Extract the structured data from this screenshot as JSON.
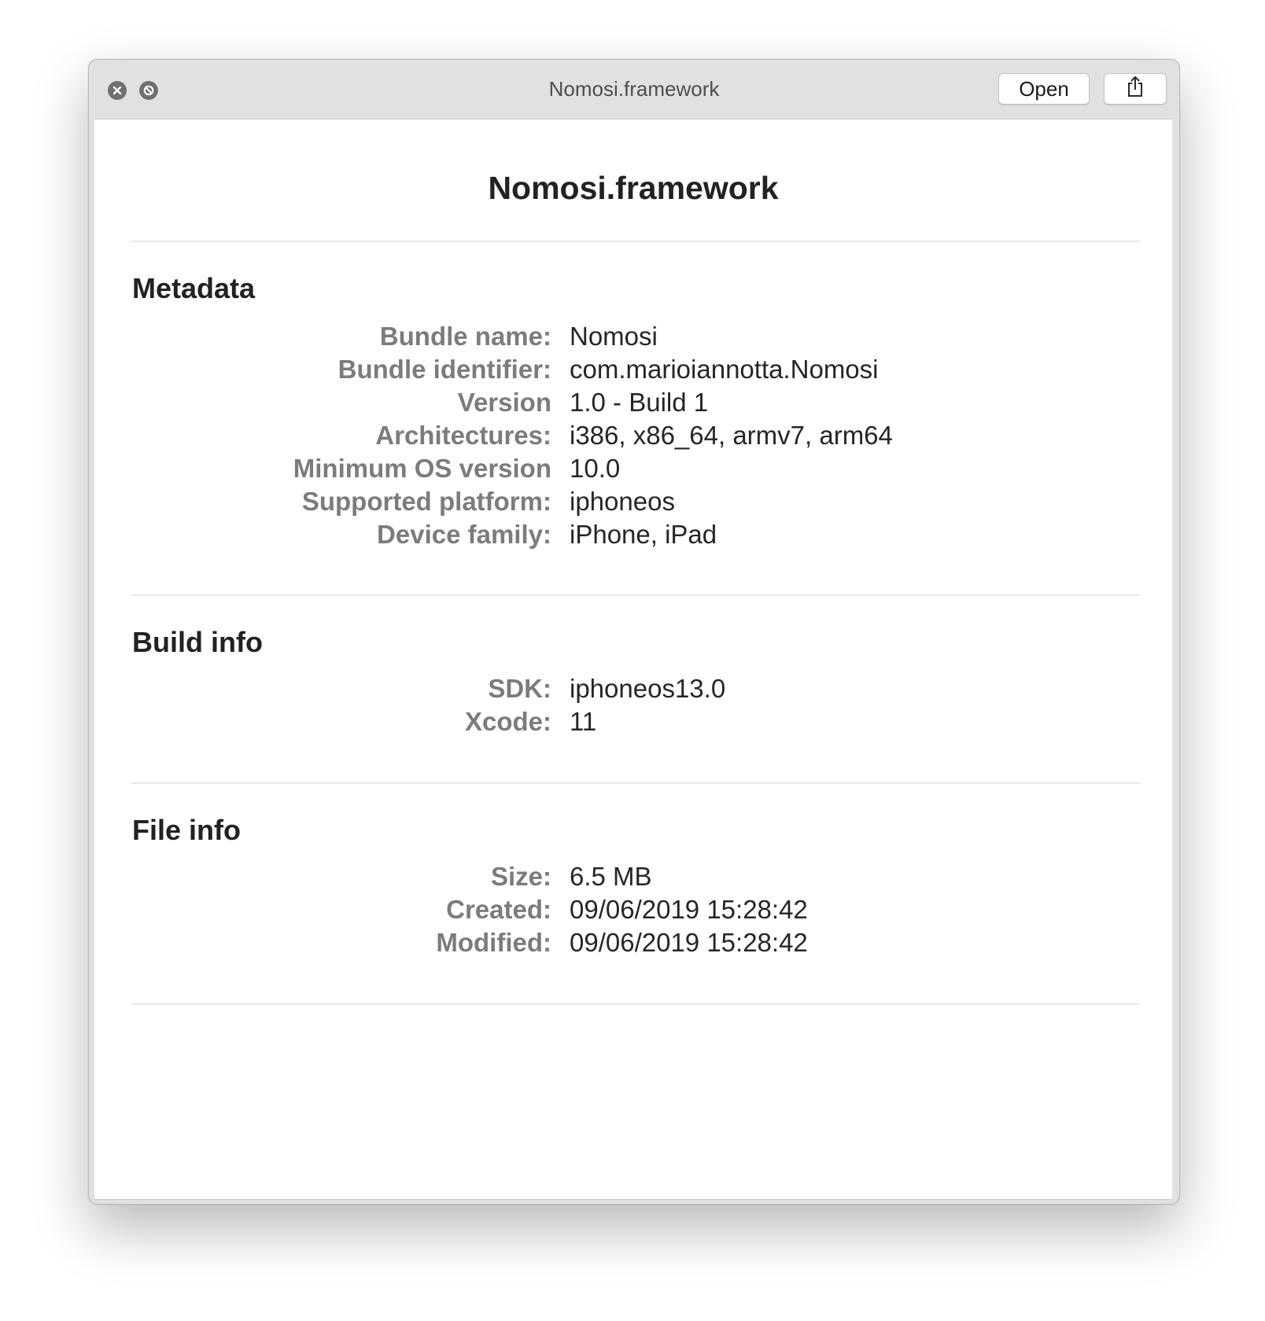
{
  "window": {
    "title": "Nomosi.framework",
    "open_label": "Open"
  },
  "icons": {
    "close": "close-circle-icon",
    "block": "block-circle-icon",
    "share": "share-icon"
  },
  "document": {
    "title": "Nomosi.framework"
  },
  "metadata": {
    "heading": "Metadata",
    "rows": [
      {
        "label": "Bundle name:",
        "value": "Nomosi"
      },
      {
        "label": "Bundle identifier:",
        "value": "com.marioiannotta.Nomosi"
      },
      {
        "label": "Version",
        "value": "1.0 - Build 1"
      },
      {
        "label": "Architectures:",
        "value": "i386, x86_64, armv7, arm64"
      },
      {
        "label": "Minimum OS version",
        "value": "10.0"
      },
      {
        "label": "Supported platform:",
        "value": "iphoneos"
      },
      {
        "label": "Device family:",
        "value": "iPhone, iPad"
      }
    ]
  },
  "build_info": {
    "heading": "Build info",
    "rows": [
      {
        "label": "SDK:",
        "value": "iphoneos13.0"
      },
      {
        "label": "Xcode:",
        "value": "11"
      }
    ]
  },
  "file_info": {
    "heading": "File info",
    "rows": [
      {
        "label": "Size:",
        "value": "6.5 MB"
      },
      {
        "label": "Created:",
        "value": "09/06/2019 15:28:42"
      },
      {
        "label": "Modified:",
        "value": "09/06/2019 15:28:42"
      }
    ]
  }
}
